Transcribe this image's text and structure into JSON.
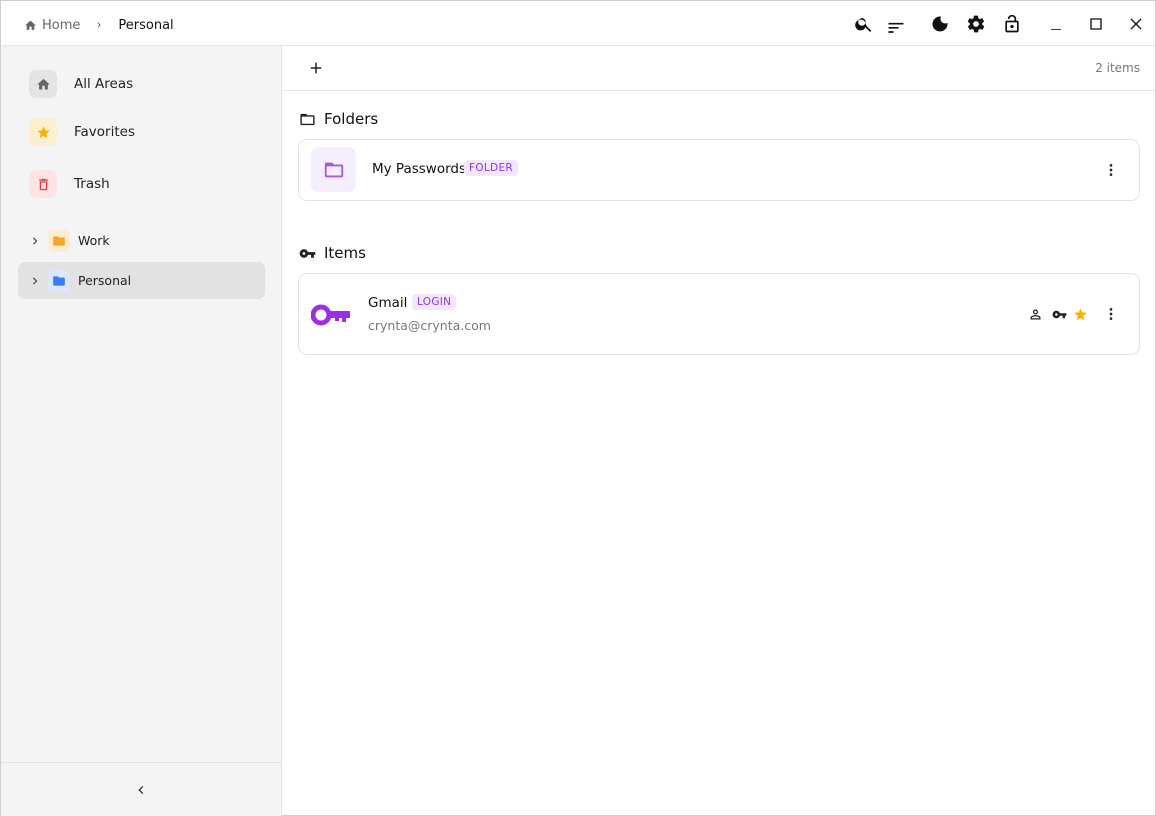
{
  "breadcrumb": {
    "home": "Home",
    "current": "Personal"
  },
  "titlebar": {
    "icons": [
      "search-icon",
      "sort-icon",
      "dark-mode-icon",
      "settings-icon",
      "lock-icon",
      "minimize-icon",
      "maximize-icon",
      "close-icon"
    ]
  },
  "sidebar": {
    "nav": [
      {
        "label": "All Areas",
        "icon": "home-icon"
      },
      {
        "label": "Favorites",
        "icon": "star-icon"
      },
      {
        "label": "Trash",
        "icon": "trash-icon"
      }
    ],
    "tree": [
      {
        "label": "Work",
        "color": "#f5a623",
        "selected": false
      },
      {
        "label": "Personal",
        "color": "#3b7cf5",
        "selected": true
      }
    ]
  },
  "toolbar": {
    "count": "2 items"
  },
  "sections": {
    "folders": "Folders",
    "items": "Items"
  },
  "folders": [
    {
      "name": "My Passwords",
      "tag": "FOLDER"
    }
  ],
  "items": [
    {
      "name": "Gmail",
      "tag": "LOGIN",
      "username": "crynta@crynta.com",
      "favorite": true
    }
  ],
  "colors": {
    "accent": "#8a2be2",
    "star": "#f5b400",
    "tag_bg": "#f2e7fd",
    "tag_fg": "#8a3ad6"
  }
}
